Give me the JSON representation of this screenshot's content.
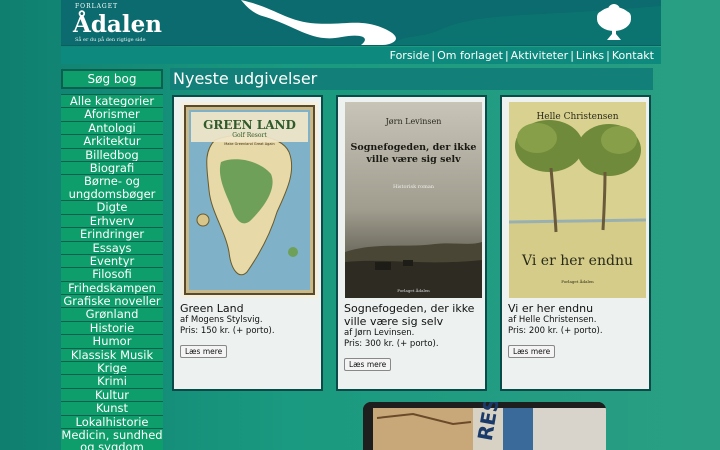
{
  "header": {
    "publisher_small": "FORLAGET",
    "logo": "Ådalen",
    "tagline": "Så er du på den rigtige side"
  },
  "topnav": {
    "items": [
      "Forside",
      "Om forlaget",
      "Aktiviteter",
      "Links",
      "Kontakt"
    ]
  },
  "sidebar": {
    "search_label": "Søg bog",
    "categories": [
      "Alle kategorier",
      "Aforismer",
      "Antologi",
      "Arkitektur",
      "Billedbog",
      "Biografi",
      "Børne- og ungdomsbøger",
      "Digte",
      "Erhverv",
      "Erindringer",
      "Essays",
      "Eventyr",
      "Filosofi",
      "Frihedskampen",
      "Grafiske noveller",
      "Grønland",
      "Historie",
      "Humor",
      "Klassisk Musik",
      "Krige",
      "Krimi",
      "Kultur",
      "Kunst",
      "Lokalhistorie",
      "Medicin, sundhed og sygdom"
    ]
  },
  "main": {
    "heading": "Nyeste udgivelser",
    "books": [
      {
        "title": "Green Land",
        "author": "af Mogens Stylsvig.",
        "price": "Pris: 150 kr. (+ porto).",
        "button": "Læs mere",
        "cover": {
          "title": "GREEN LAND",
          "subtitle": "Golf Resort",
          "small": "Make Greenland Great Again"
        }
      },
      {
        "title": "Sognefogeden, der ikke ville være sig selv",
        "author": "af Jørn Levinsen.",
        "price": "Pris: 300 kr. (+ porto).",
        "button": "Læs mere",
        "cover": {
          "author": "Jørn Levinsen",
          "title": "Sognefogeden, der ikke ville være sig selv",
          "subtitle": "Historisk roman",
          "publisher": "Forlaget Ådalen"
        }
      },
      {
        "title": "Vi er her endnu",
        "author": "af Helle Christensen.",
        "price": "Pris: 200 kr. (+ porto).",
        "button": "Læs mere",
        "cover": {
          "author": "Helle Christensen",
          "title": "Vi er her endnu",
          "publisher": "Forlaget Ådalen"
        }
      }
    ],
    "photo_text": "RES"
  },
  "colors": {
    "header_bg": "#0b6b6e",
    "nav_bg": "#0d8a7d",
    "sidebar_item": "#0e9e6b",
    "heading_bg": "#128078",
    "card_bg": "#edf2f1"
  }
}
